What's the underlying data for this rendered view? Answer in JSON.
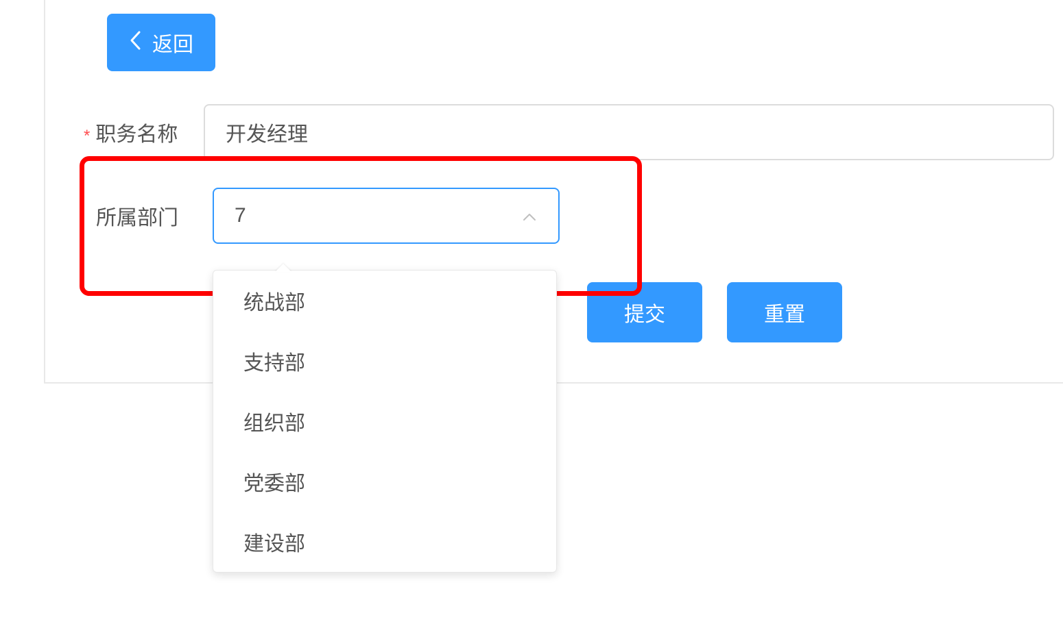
{
  "header": {
    "back_label": "返回"
  },
  "form": {
    "job_title_label": "职务名称",
    "job_title_value": "开发经理",
    "department_label": "所属部门",
    "department_value": "7",
    "department_options": [
      "统战部",
      "支持部",
      "组织部",
      "党委部",
      "建设部"
    ]
  },
  "actions": {
    "submit_label": "提交",
    "reset_label": "重置"
  },
  "colors": {
    "primary": "#3399ff",
    "danger": "#ff0000"
  }
}
